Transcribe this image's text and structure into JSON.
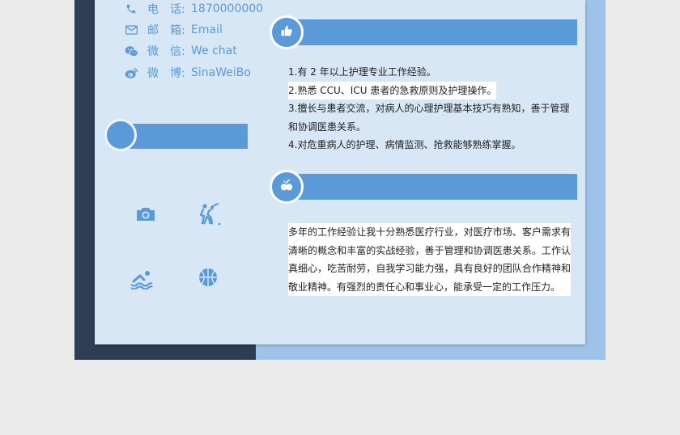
{
  "contact": {
    "phone": {
      "label": "电　话:",
      "value": "1870000000",
      "icon": "phone-icon"
    },
    "email": {
      "label": "邮　箱:",
      "value": "Email",
      "icon": "mail-icon"
    },
    "wechat": {
      "label": "微　信:",
      "value": "We chat",
      "icon": "wechat-icon"
    },
    "weibo": {
      "label": "微　博:",
      "value": "SinaWeiBo",
      "icon": "weibo-icon"
    }
  },
  "hobbies": [
    "camera-icon",
    "badminton-icon",
    "swimming-icon",
    "basketball-icon"
  ],
  "skills": {
    "icon": "thumbs-up-icon",
    "items": [
      "1.有 2 年以上护理专业工作经验。",
      "2.熟悉 CCU、ICU 患者的急救原则及护理操作。",
      "3.擅长与患者交流，对病人的心理护理基本技巧有熟知，善于管理",
      "和协调医患关系。",
      "4.对危重病人的护理、病情监测、抢救能够熟练掌握。"
    ]
  },
  "self_evaluation": {
    "icon": "fruit-icon",
    "text": "多年的工作经验让我十分熟悉医疗行业，对医疗市场、客户需求有清晰的概念和丰富的实战经验，善于管理和协调医患关系。工作认真细心，吃苦耐劳，自我学习能力强，具有良好的团队合作精神和敬业精神。有强烈的责任心和事业心，能承受一定的工作压力。"
  },
  "colors": {
    "accent": "#5b9ad8",
    "dark": "#2e3e52",
    "sheet": "#d8e7f6",
    "light_blue": "#9ec2e8"
  }
}
